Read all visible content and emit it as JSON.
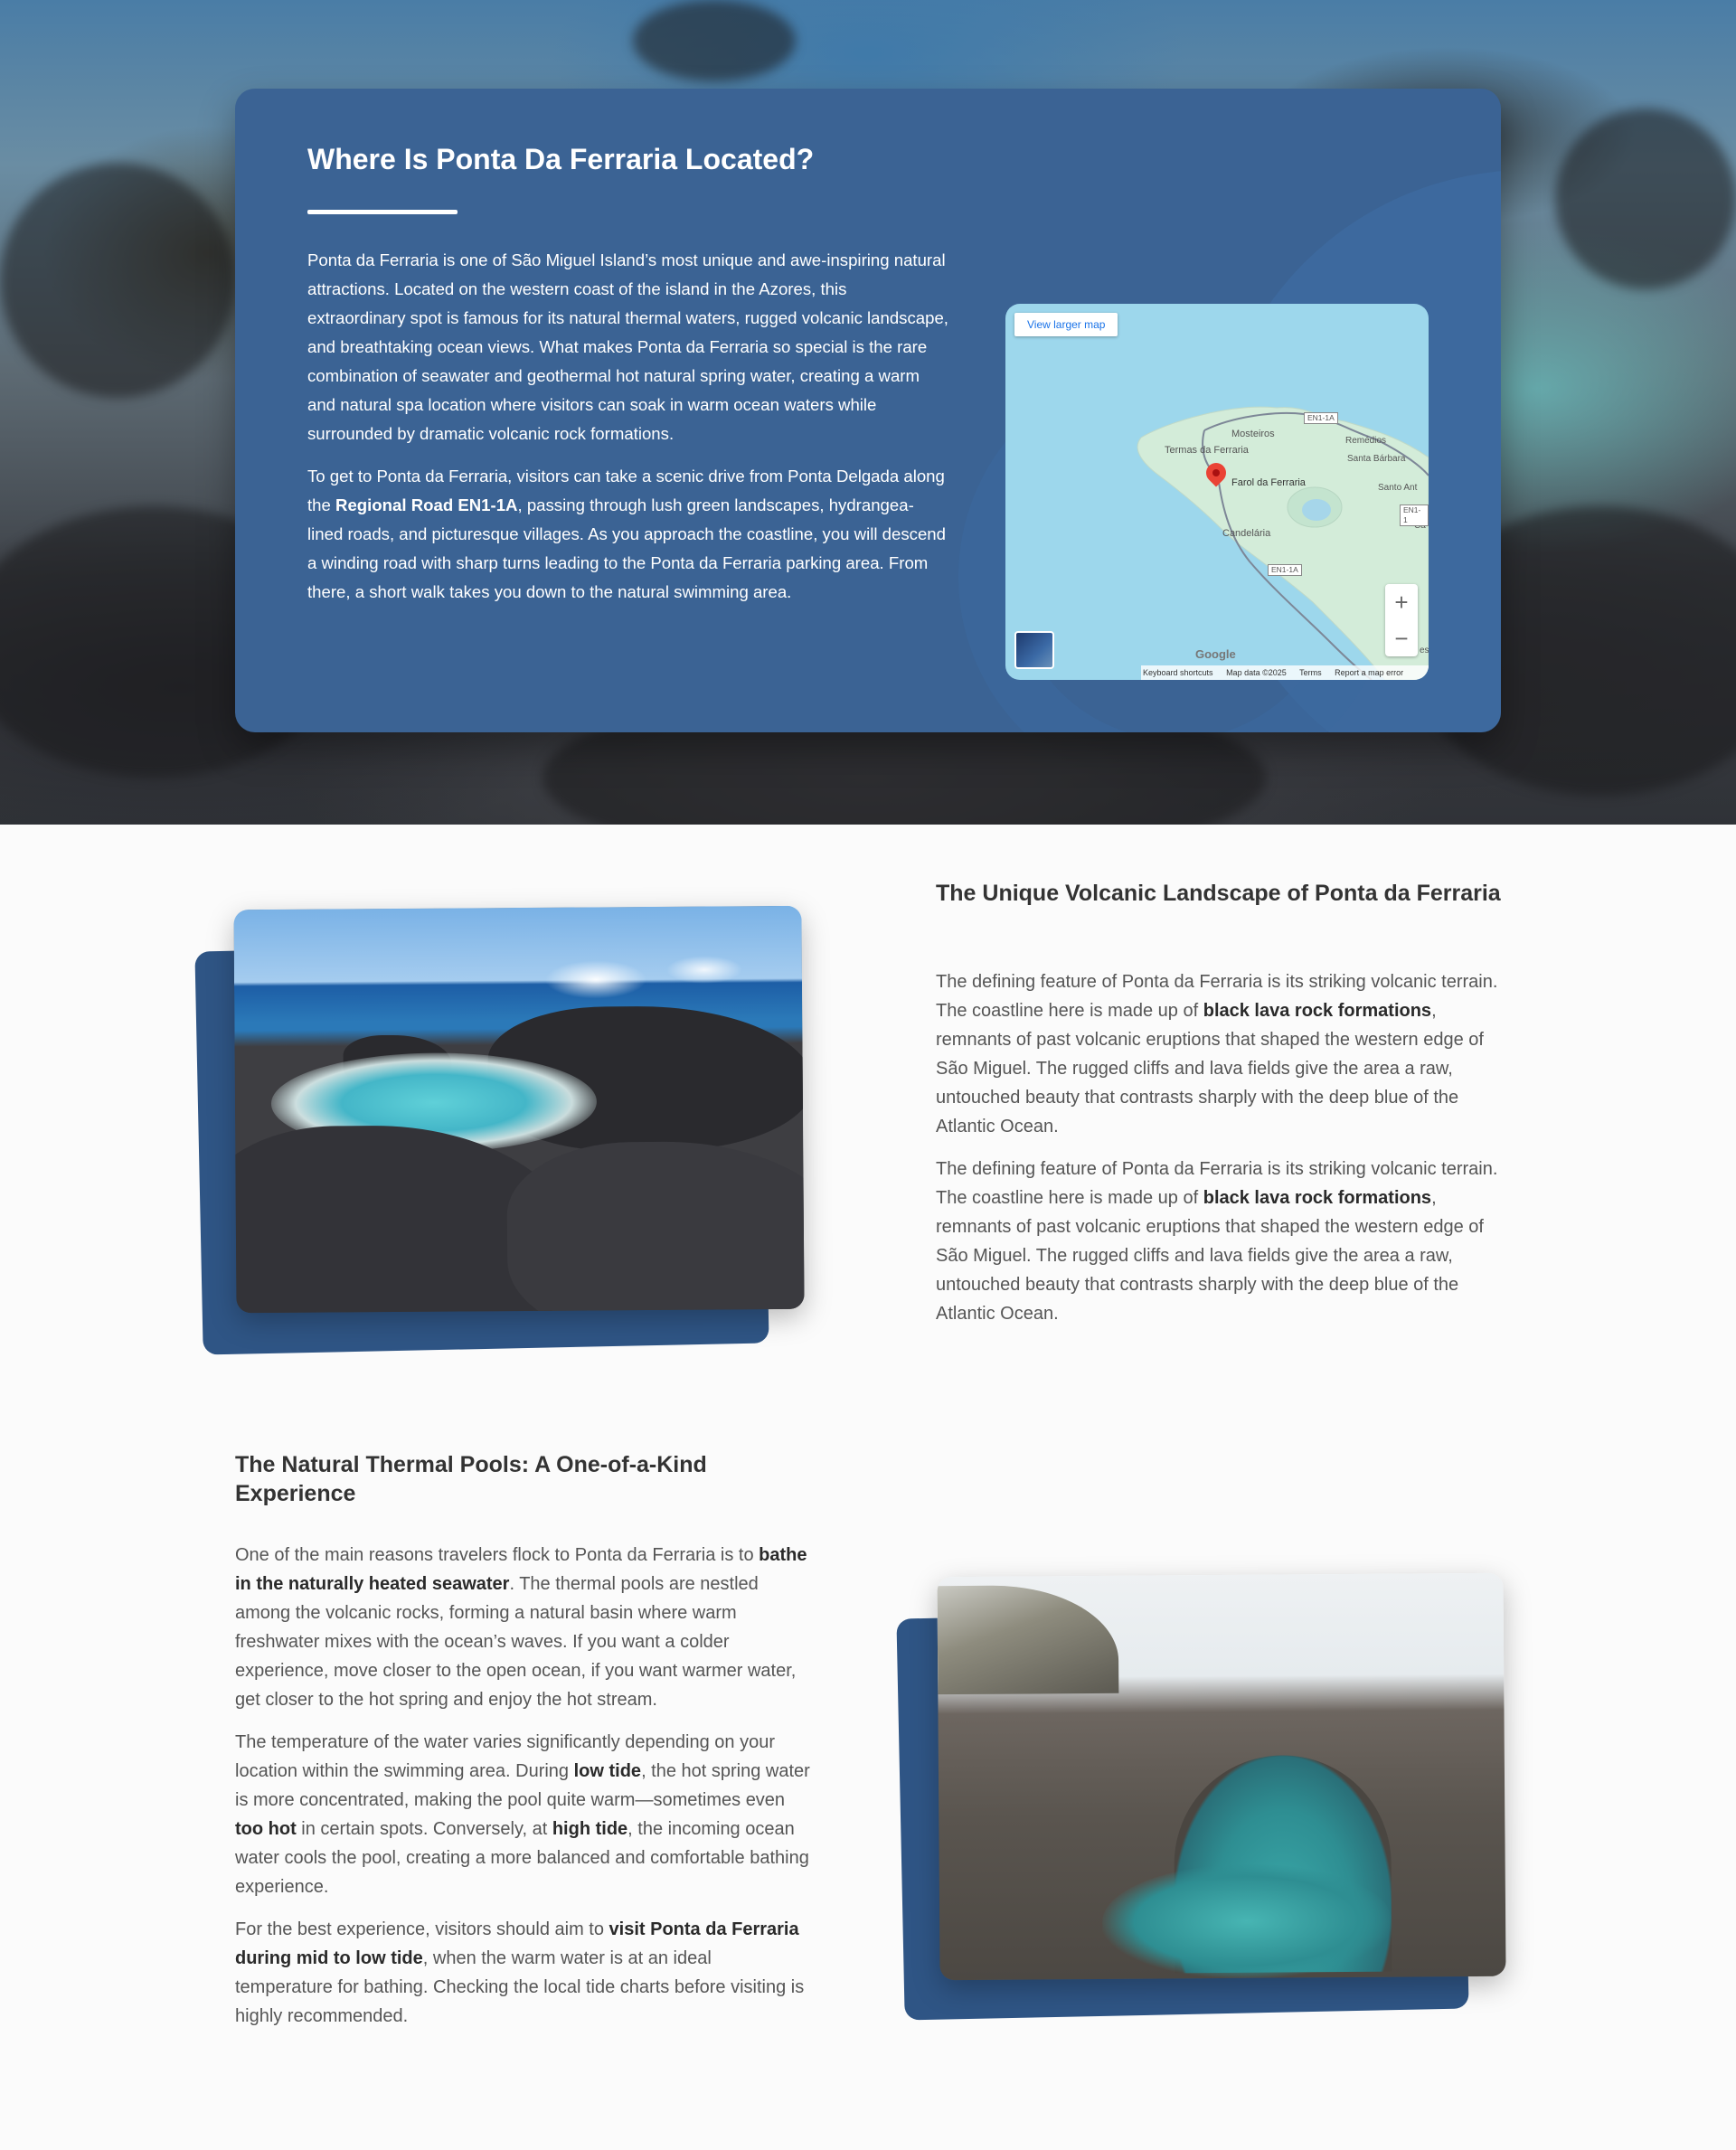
{
  "location": {
    "title": "Where Is Ponta Da Ferraria Located?",
    "p1": "Ponta da Ferraria is one of São Miguel Island’s most unique and awe-inspiring natural attractions. Located on the western coast of the island in the Azores, this extraordinary spot is famous for its natural thermal waters, rugged volcanic landscape, and breathtaking ocean views. What makes Ponta da Ferraria so special is the rare combination of seawater and geothermal hot natural spring water, creating a warm and natural spa location where visitors can soak in warm ocean waters while surrounded by dramatic volcanic rock formations.",
    "p2_a": "To get to Ponta da Ferraria, visitors can take a scenic drive from Ponta Delgada along the ",
    "p2_b": "Regional Road EN1-1A",
    "p2_c": ", passing through lush green landscapes, hydrangea-lined roads, and picturesque villages. As you approach the coastline, you will descend a winding road with sharp turns leading to the Ponta da Ferraria parking area. From there, a short walk takes you down to the natural swimming area.",
    "map": {
      "larger_map": "View larger map",
      "labels": {
        "mosteiros": "Mosteiros",
        "termas": "Termas da Ferraria",
        "farol": "Farol da Ferraria",
        "candelaria": "Candelária",
        "remedios": "Remédios",
        "santa_barbara": "Santa Bárbara",
        "santo_ant": "Santo Ant",
        "ca": "Ca",
        "es": "es"
      },
      "road_1": "EN1-1A",
      "road_2": "EN1-1A",
      "road_3": "EN1-1",
      "zoom_in": "+",
      "zoom_out": "−",
      "google": "Google",
      "footer": [
        "Keyboard shortcuts",
        "Map data ©2025",
        "Terms",
        "Report a map error"
      ]
    }
  },
  "volcanic": {
    "title": "The Unique Volcanic Landscape of Ponta da Ferraria",
    "p1_a": "The defining feature of Ponta da Ferraria is its striking volcanic terrain. The coastline here is made up of ",
    "p1_b": "black lava rock formations",
    "p1_c": ", remnants of past volcanic eruptions that shaped the western edge of São Miguel. The rugged cliffs and lava fields give the area a raw, untouched beauty that contrasts sharply with the deep blue of the Atlantic Ocean.",
    "p2_a": "The defining feature of Ponta da Ferraria is its striking volcanic terrain. The coastline here is made up of ",
    "p2_b": "black lava rock formations",
    "p2_c": ", remnants of past volcanic eruptions that shaped the western edge of São Miguel. The rugged cliffs and lava fields give the area a raw, untouched beauty that contrasts sharply with the deep blue of the Atlantic Ocean."
  },
  "pools": {
    "title": "The Natural Thermal Pools: A One-of-a-Kind Experience",
    "p1_a": "One of the main reasons travelers flock to Ponta da Ferraria is to ",
    "p1_b": "bathe in the naturally heated seawater",
    "p1_c": ". The thermal pools are nestled among the volcanic rocks, forming a natural basin where warm freshwater mixes with the ocean’s waves. If you want a colder experience, move closer to the open ocean, if you want warmer water, get closer to the hot spring and enjoy the hot stream.",
    "p2_a": "The temperature of the water varies significantly depending on your location within the swimming area. During ",
    "p2_b": "low tide",
    "p2_c": ", the hot spring water is more concentrated, making the pool quite warm—sometimes even ",
    "p2_d": "too hot",
    "p2_e": " in certain spots. Conversely, at ",
    "p2_f": "high tide",
    "p2_g": ", the incoming ocean water cools the pool, creating a more balanced and comfortable bathing experience.",
    "p3_a": "For the best experience, visitors should aim to ",
    "p3_b": "visit Ponta da Ferraria during mid to low tide",
    "p3_c": ", when the warm water is at an ideal temperature for bathing. Checking the local tide charts before visiting is highly recommended."
  },
  "colors": {
    "card": "#3b6394",
    "photo_back": "#2f5585",
    "heading": "#333333",
    "body": "#555555"
  }
}
